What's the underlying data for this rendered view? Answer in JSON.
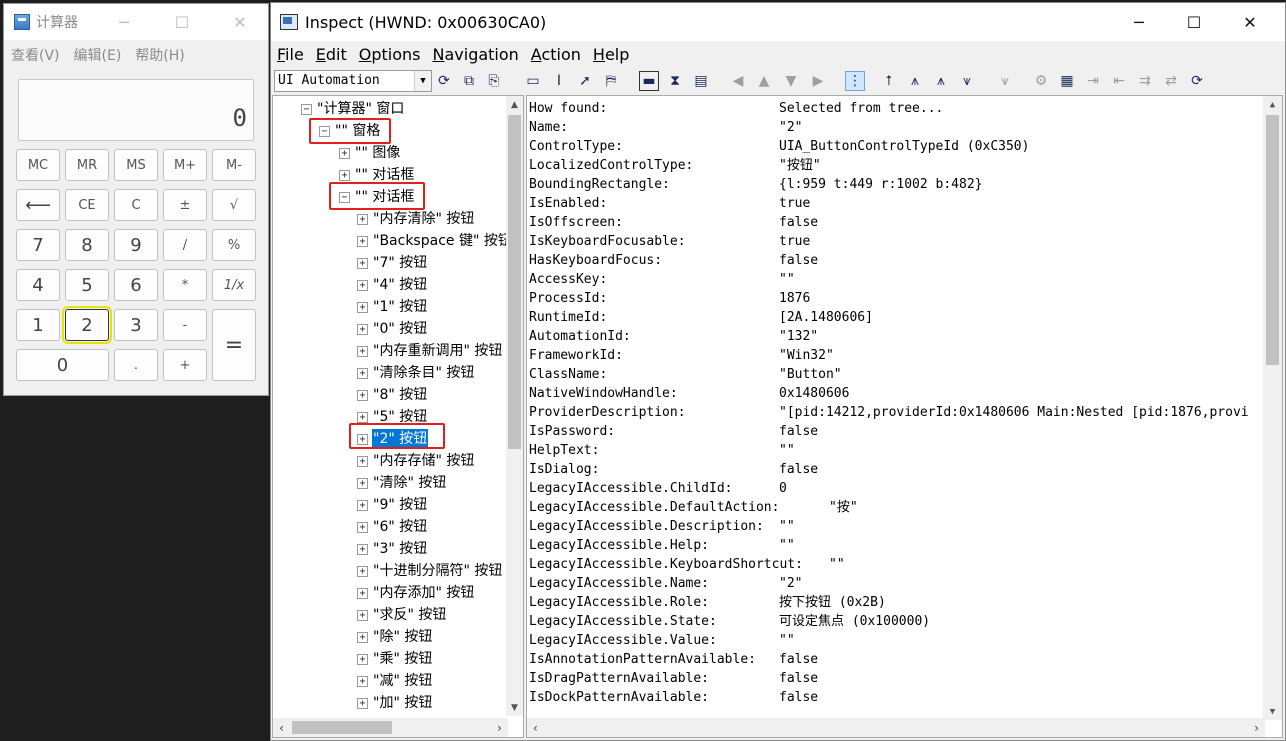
{
  "calculator": {
    "title": "计算器",
    "menus": [
      "查看(V)",
      "编辑(E)",
      "帮助(H)"
    ],
    "display": "0",
    "keys": {
      "mc": "MC",
      "mr": "MR",
      "ms": "MS",
      "mplus": "M+",
      "mminus": "M-",
      "back": "⟵",
      "ce": "CE",
      "c": "C",
      "pm": "±",
      "sqrt": "√",
      "k7": "7",
      "k8": "8",
      "k9": "9",
      "div": "/",
      "pct": "%",
      "k4": "4",
      "k5": "5",
      "k6": "6",
      "mul": "*",
      "recip": "1/x",
      "k1": "1",
      "k2": "2",
      "k3": "3",
      "sub": "-",
      "eq": "=",
      "k0": "0",
      "dot": ".",
      "add": "+"
    }
  },
  "inspect": {
    "title": "Inspect  (HWND: 0x00630CA0)",
    "menus": [
      {
        "u": "F",
        "rest": "ile"
      },
      {
        "u": "E",
        "rest": "dit"
      },
      {
        "u": "O",
        "rest": "ptions"
      },
      {
        "u": "N",
        "rest": "avigation"
      },
      {
        "u": "A",
        "rest": "ction"
      },
      {
        "u": "H",
        "rest": "elp"
      }
    ],
    "mode": "UI Automation",
    "tree": [
      {
        "label": "\"计算器\" 窗口"
      },
      {
        "label": "\"\" 窗格"
      },
      {
        "label": "\"\" 图像"
      },
      {
        "label": "\"\" 对话框"
      },
      {
        "label": "\"\" 对话框"
      },
      {
        "label": "\"内存清除\" 按钮"
      },
      {
        "label": "\"Backspace 键\" 按钮"
      },
      {
        "label": "\"7\" 按钮"
      },
      {
        "label": "\"4\" 按钮"
      },
      {
        "label": "\"1\" 按钮"
      },
      {
        "label": "\"0\" 按钮"
      },
      {
        "label": "\"内存重新调用\" 按钮"
      },
      {
        "label": "\"清除条目\" 按钮"
      },
      {
        "label": "\"8\" 按钮"
      },
      {
        "label": "\"5\" 按钮"
      },
      {
        "label": "\"2\" 按钮"
      },
      {
        "label": "\"内存存储\" 按钮"
      },
      {
        "label": "\"清除\" 按钮"
      },
      {
        "label": "\"9\" 按钮"
      },
      {
        "label": "\"6\" 按钮"
      },
      {
        "label": "\"3\" 按钮"
      },
      {
        "label": "\"十进制分隔符\" 按钮"
      },
      {
        "label": "\"内存添加\" 按钮"
      },
      {
        "label": "\"求反\" 按钮"
      },
      {
        "label": "\"除\" 按钮"
      },
      {
        "label": "\"乘\" 按钮"
      },
      {
        "label": "\"减\" 按钮"
      },
      {
        "label": "\"加\" 按钮"
      }
    ],
    "properties": [
      {
        "k": "How found:",
        "v": "Selected from tree..."
      },
      {
        "k": "Name:",
        "v": "\"2\""
      },
      {
        "k": "ControlType:",
        "v": "UIA_ButtonControlTypeId (0xC350)"
      },
      {
        "k": "LocalizedControlType:",
        "v": "\"按钮\""
      },
      {
        "k": "BoundingRectangle:",
        "v": "{l:959 t:449 r:1002 b:482}"
      },
      {
        "k": "IsEnabled:",
        "v": "true"
      },
      {
        "k": "IsOffscreen:",
        "v": "false"
      },
      {
        "k": "IsKeyboardFocusable:",
        "v": "true"
      },
      {
        "k": "HasKeyboardFocus:",
        "v": "false"
      },
      {
        "k": "AccessKey:",
        "v": "\"\""
      },
      {
        "k": "ProcessId:",
        "v": "1876"
      },
      {
        "k": "RuntimeId:",
        "v": "[2A.1480606]"
      },
      {
        "k": "AutomationId:",
        "v": "\"132\""
      },
      {
        "k": "FrameworkId:",
        "v": "\"Win32\""
      },
      {
        "k": "ClassName:",
        "v": "\"Button\""
      },
      {
        "k": "NativeWindowHandle:",
        "v": "0x1480606"
      },
      {
        "k": "ProviderDescription:",
        "v": "\"[pid:14212,providerId:0x1480606 Main:Nested [pid:1876,provi"
      },
      {
        "k": "IsPassword:",
        "v": "false"
      },
      {
        "k": "HelpText:",
        "v": "\"\""
      },
      {
        "k": "IsDialog:",
        "v": "false"
      },
      {
        "k": "LegacyIAccessible.ChildId:",
        "v": "0"
      },
      {
        "k": "LegacyIAccessible.DefaultAction:",
        "v": "\"按\""
      },
      {
        "k": "LegacyIAccessible.Description:",
        "v": "\"\""
      },
      {
        "k": "LegacyIAccessible.Help:",
        "v": "\"\""
      },
      {
        "k": "LegacyIAccessible.KeyboardShortcut:",
        "v": "\"\""
      },
      {
        "k": "LegacyIAccessible.Name:",
        "v": "\"2\""
      },
      {
        "k": "LegacyIAccessible.Role:",
        "v": "按下按钮 (0x2B)"
      },
      {
        "k": "LegacyIAccessible.State:",
        "v": "可设定焦点 (0x100000)"
      },
      {
        "k": "LegacyIAccessible.Value:",
        "v": "\"\""
      },
      {
        "k": "IsAnnotationPatternAvailable:",
        "v": "false"
      },
      {
        "k": "IsDragPatternAvailable:",
        "v": "false"
      },
      {
        "k": "IsDockPatternAvailable:",
        "v": "false"
      }
    ]
  },
  "colors": {
    "selection": "#0078d7",
    "highlight": "#e02020",
    "focus_outline": "#e4e400"
  }
}
